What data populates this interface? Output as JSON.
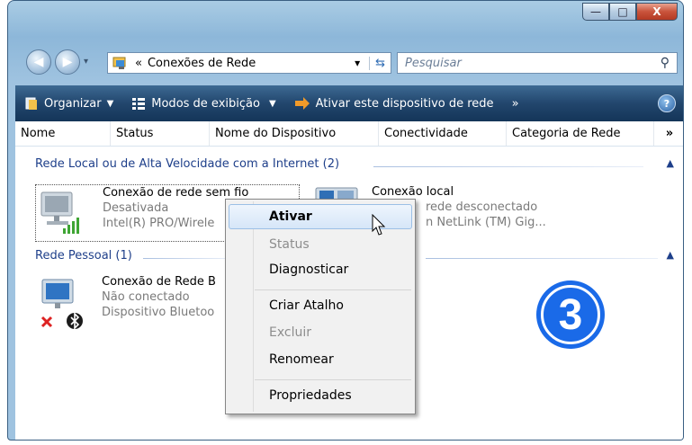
{
  "caption_buttons": {
    "minimize": "—",
    "maximize": "□",
    "close": "X"
  },
  "address": {
    "back_icon": "back-arrow-icon",
    "forward_icon": "forward-arrow-icon",
    "breadcrumb_prefix": "«",
    "location": "Conexões de Rede",
    "dropdown": "▾",
    "refresh": "⇆",
    "search_placeholder": "Pesquisar"
  },
  "toolbar": {
    "organize": "Organizar",
    "views": "Modos de exibição",
    "enable_device": "Ativar este dispositivo de rede",
    "more": "»",
    "help": "?"
  },
  "columns": [
    "Nome",
    "Status",
    "Nome do Dispositivo",
    "Conectividade",
    "Categoria de Rede"
  ],
  "columns_more": "»",
  "groups": [
    {
      "title": "Rede Local ou de Alta Velocidade com a Internet (2)",
      "items": [
        {
          "name": "Conexão de rede sem fio",
          "status": "Desativada",
          "device": "Intel(R) PRO/Wirele"
        },
        {
          "name": "Conexão local",
          "status": "rede desconectado",
          "device": "n NetLink (TM) Gig..."
        }
      ]
    },
    {
      "title": "Rede Pessoal (1)",
      "items": [
        {
          "name": "Conexão de Rede B",
          "status": "Não conectado",
          "device": "Dispositivo Bluetoo"
        }
      ]
    }
  ],
  "context_menu": {
    "items": [
      {
        "label": "Ativar",
        "bold": true
      },
      {
        "label": "Status",
        "disabled": true
      },
      {
        "label": "Diagnosticar"
      },
      {
        "label": "Criar Atalho"
      },
      {
        "label": "Excluir",
        "disabled": true
      },
      {
        "label": "Renomear"
      },
      {
        "label": "Propriedades"
      }
    ]
  },
  "step_badge": "3",
  "colors": {
    "accent": "#1a6ae8",
    "toolbar": "#22466d",
    "group_text": "#1e3f8a"
  }
}
